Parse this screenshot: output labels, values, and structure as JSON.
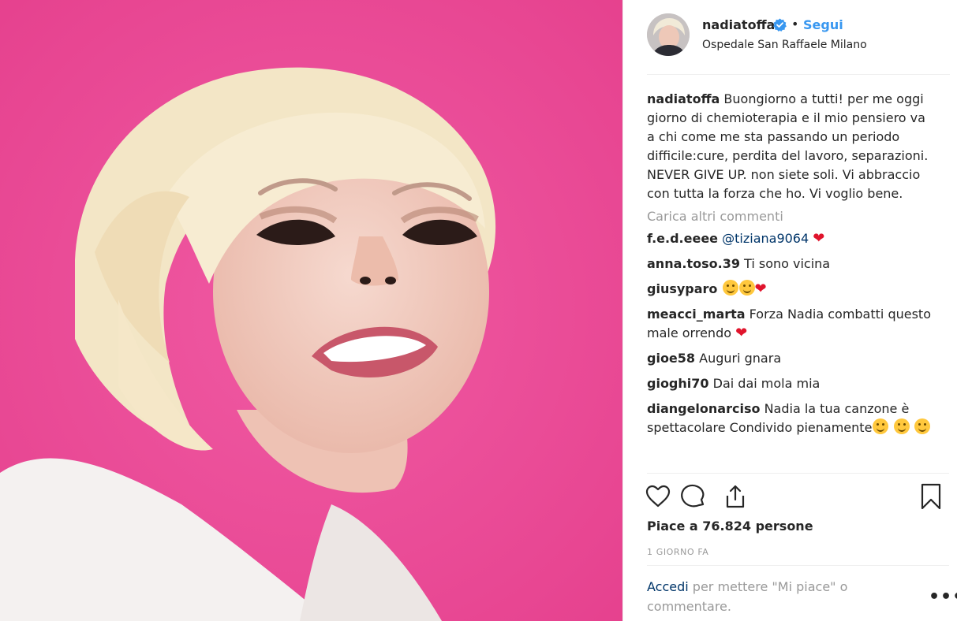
{
  "post": {
    "username": "nadiatoffa",
    "follow_separator": "•",
    "follow_label": "Segui",
    "location": "Ospedale San Raffaele Milano",
    "caption": "Buongiorno a tutti! per me oggi giorno di chemioterapia e il mio pensiero va a chi come me sta passando un periodo difficile:cure, perdita del lavoro, separazioni. NEVER GIVE UP. non siete soli. Vi abbraccio con tutta la forza che ho. Vi voglio bene.",
    "load_more": "Carica altri commenti",
    "likes": "Piace a 76.824 persone",
    "time": "1 GIORNO FA",
    "login_link": "Accedi",
    "login_text": " per mettere \"Mi piace\" o commentare.",
    "more_options": "•••",
    "background_color": "#ea4b97",
    "accent_color": "#3897f0"
  },
  "comments": [
    {
      "user": "f.e.d.eeee",
      "mention": "@tiziana9064",
      "text": "",
      "heart": "❤"
    },
    {
      "user": "anna.toso.39",
      "text": "Ti sono vicina"
    },
    {
      "user": "giusyparo",
      "heart": "❤"
    },
    {
      "user": "meacci_marta",
      "text": "Forza Nadia combatti questo male orrendo",
      "heart": "❤"
    },
    {
      "user": "gioe58",
      "text": "Auguri gnara"
    },
    {
      "user": "gioghi70",
      "text": "Dai dai mola mia"
    },
    {
      "user": "diangelonarciso",
      "text": "Nadia la tua canzone è spettacolare Condivido pienamente"
    }
  ],
  "icons": [
    "verified-badge-icon",
    "heart-icon",
    "comment-icon",
    "share-icon",
    "bookmark-icon",
    "more-options-icon"
  ]
}
